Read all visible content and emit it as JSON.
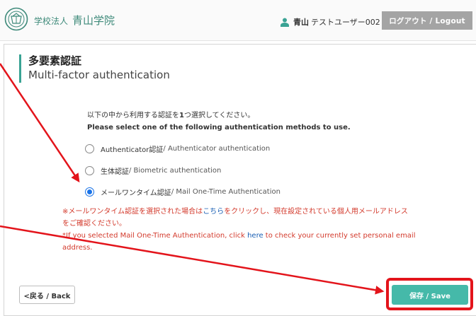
{
  "header": {
    "org_kind": "学校法人",
    "org_name": "青山学院",
    "user_name": "青山",
    "user_rest": "テストユーザー002",
    "logout_label": "ログアウト / Logout"
  },
  "page": {
    "title_ja": "多要素認証",
    "title_en": "Multi-factor authentication"
  },
  "instructions": {
    "ja_before": "以下の中から利用する認証を",
    "ja_bold": "1",
    "ja_after": "つ選択してください。",
    "en": "Please select one of the following authentication methods to use."
  },
  "options": [
    {
      "ja": "Authenticator認証",
      "en": " / Authenticator authentication",
      "selected": false
    },
    {
      "ja": "生体認証",
      "en": " / Biometric authentication",
      "selected": false
    },
    {
      "ja": "メールワンタイム認証",
      "en": " / Mail One-Time Authentication",
      "selected": true
    }
  ],
  "notice": {
    "ja_line1_before": "※メールワンタイム認証を選択された場合は",
    "ja_link": "こちら",
    "ja_line1_after": "をクリックし、現在設定されている個人用メールアドレス",
    "ja_line2": "をご確認ください。",
    "en_before": "*If you selected Mail One-Time Authentication, click ",
    "en_link": "here",
    "en_after": " to check your currently set personal email",
    "en_line2": "address."
  },
  "buttons": {
    "back_label": "<戻る / Back",
    "save_label": "保存 / Save"
  },
  "colors": {
    "accent": "#45b9a9",
    "annotation": "#e3141b",
    "link": "#1a5fb4",
    "notice": "#d33a2c"
  }
}
